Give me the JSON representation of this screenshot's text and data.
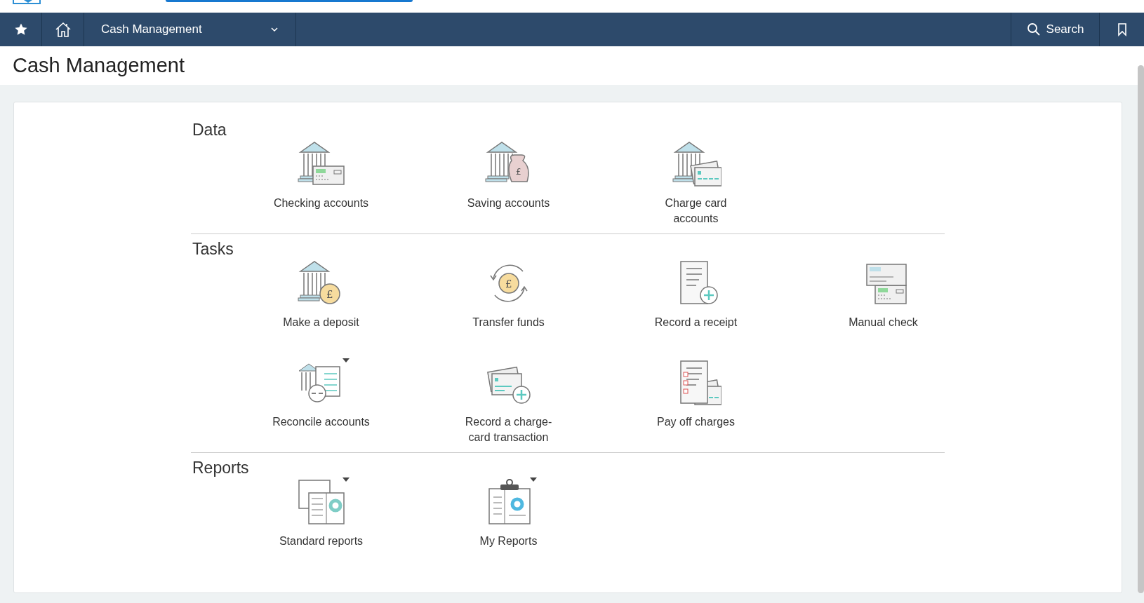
{
  "nav": {
    "module": "Cash Management",
    "search": "Search"
  },
  "page_title": "Cash Management",
  "sections": [
    {
      "title": "Data",
      "items": [
        {
          "label": "Checking accounts",
          "kind": "bank-check",
          "has_menu": false
        },
        {
          "label": "Saving accounts",
          "kind": "bank-bag",
          "symbol": "£",
          "has_menu": false
        },
        {
          "label": "Charge card accounts",
          "kind": "bank-card",
          "has_menu": false
        }
      ]
    },
    {
      "title": "Tasks",
      "items": [
        {
          "label": "Make a deposit",
          "kind": "bank-coin",
          "symbol": "£",
          "has_menu": false
        },
        {
          "label": "Transfer funds",
          "kind": "transfer",
          "symbol": "£",
          "has_menu": false
        },
        {
          "label": "Record a receipt",
          "kind": "receipt",
          "has_menu": false
        },
        {
          "label": "Manual check",
          "kind": "check",
          "has_menu": false
        },
        {
          "label": "Reconcile accounts",
          "kind": "reconcile",
          "has_menu": true
        },
        {
          "label": "Record a charge-card transaction",
          "kind": "card-plus",
          "has_menu": false
        },
        {
          "label": "Pay off charges",
          "kind": "payoff",
          "has_menu": false
        }
      ]
    },
    {
      "title": "Reports",
      "items": [
        {
          "label": "Standard reports",
          "kind": "reports",
          "has_menu": true
        },
        {
          "label": "My Reports",
          "kind": "clipboard",
          "has_menu": true
        }
      ]
    }
  ]
}
